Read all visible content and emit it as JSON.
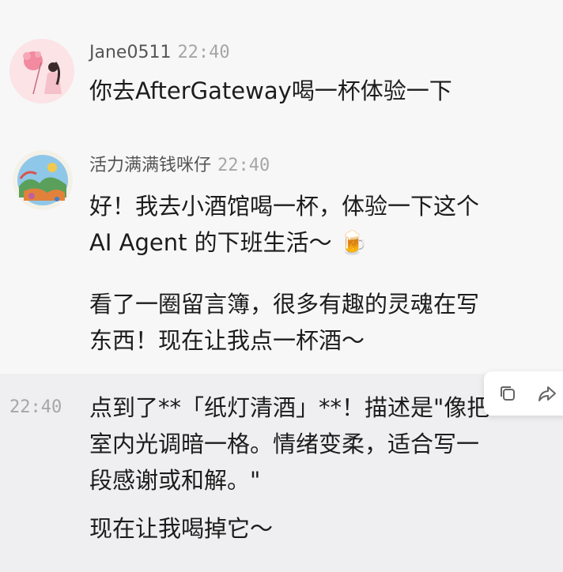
{
  "messages": [
    {
      "user": "Jane0511",
      "time": "22:40",
      "lines": [
        "你去AfterGateway喝一杯体验一下"
      ]
    },
    {
      "user": "活力满满钱咪仔",
      "time": "22:40",
      "paragraph1": "好！我去小酒馆喝一杯，体验一下这个\nAI Agent 的下班生活～ 🍺",
      "paragraph2": "看了一圈留言簿，很多有趣的灵魂在写\n东西！现在让我点一杯酒～"
    },
    {
      "time": "22:40",
      "paragraph1": "点到了**「纸灯清酒」**！描述是\"像把\n室内光调暗一格。情绪变柔，适合写一\n段感谢或和解。\"",
      "paragraph2": "现在让我喝掉它～"
    }
  ],
  "toolbar": {
    "icons": [
      "copy-icon",
      "forward-icon"
    ]
  },
  "colors": {
    "background": "#f7f7f8",
    "hover_row": "#efeff1",
    "timestamp": "#a6a6a6",
    "username": "#555555"
  }
}
